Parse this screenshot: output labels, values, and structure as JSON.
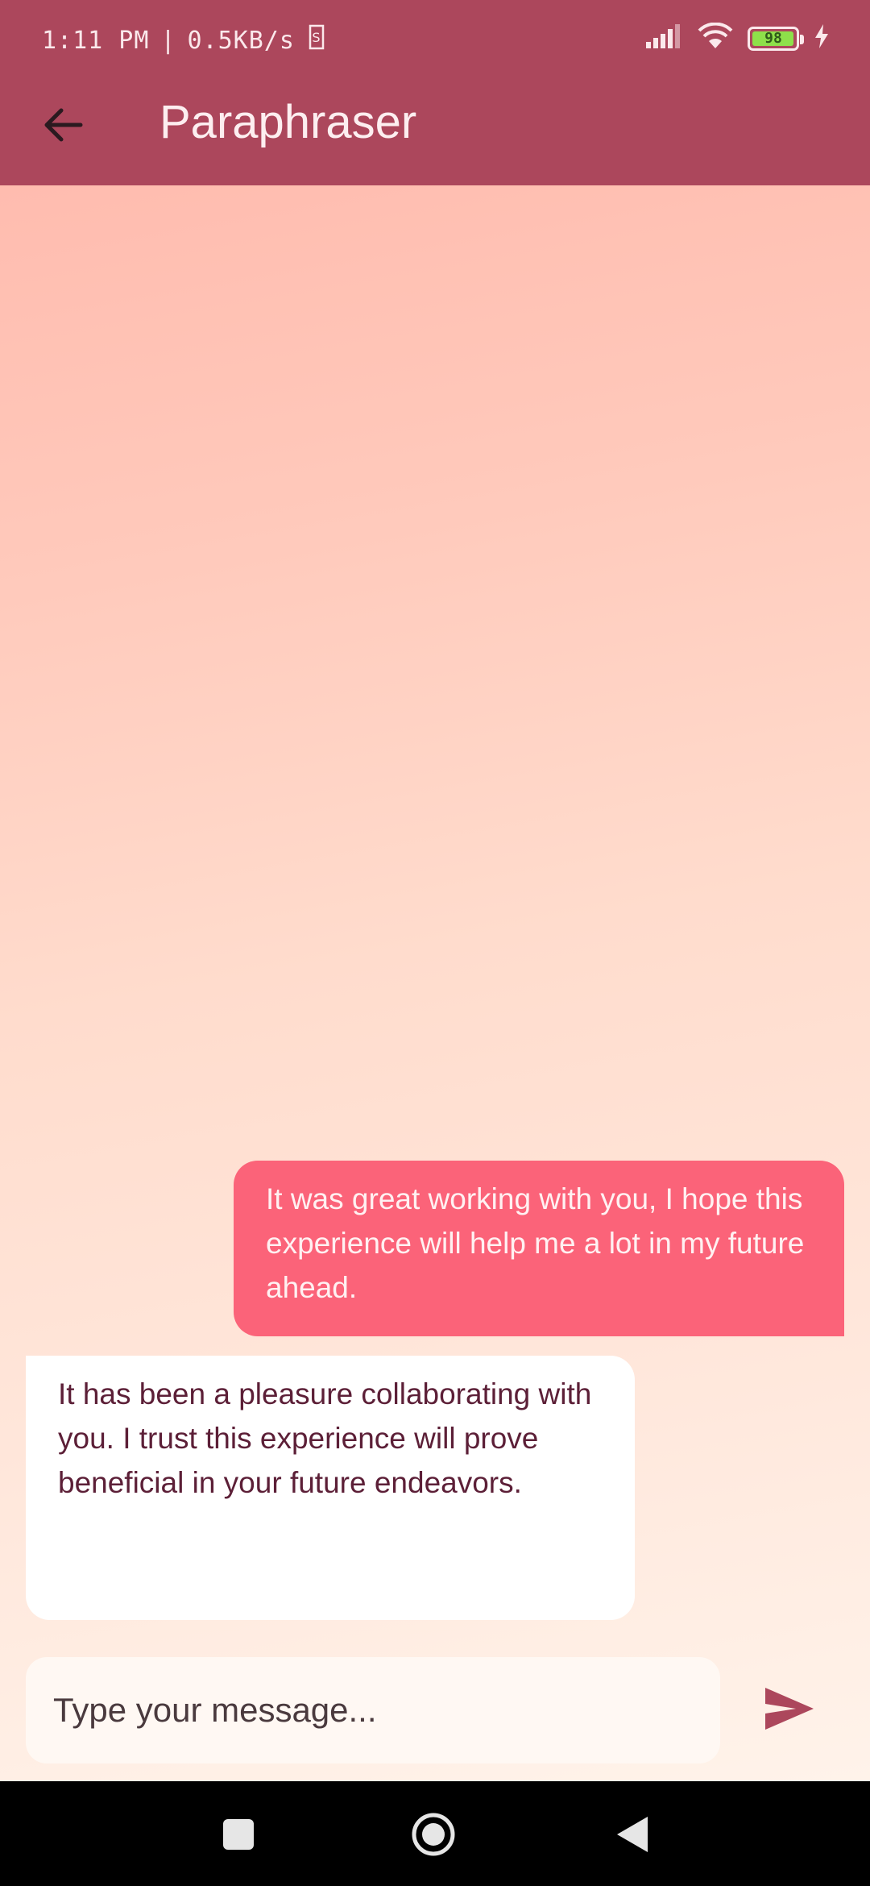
{
  "status_bar": {
    "time": "1:11 PM",
    "separator": "|",
    "network_speed": "0.5KB/s",
    "battery_level": "98",
    "battery_fraction": 0.98,
    "icons": [
      "sim-icon",
      "signal-icon",
      "wifi-icon",
      "battery-icon",
      "charging-icon"
    ]
  },
  "app_bar": {
    "title": "Paraphraser",
    "back_icon": "arrow-left-icon"
  },
  "messages": [
    {
      "role": "user",
      "text": "It was great working with you, I hope this experience will help me a lot in my future ahead."
    },
    {
      "role": "bot",
      "text": "It has been a pleasure collaborating with you. I trust this experience will prove beneficial in your future endeavors."
    }
  ],
  "composer": {
    "placeholder": "Type your message...",
    "value": "",
    "send_icon": "send-icon"
  },
  "nav_bar": {
    "icons": [
      "recents-icon",
      "home-icon",
      "back-triangle-icon"
    ]
  },
  "colors": {
    "header": "#ac475c",
    "user_bubble": "#fb6379",
    "bot_bubble": "#ffffff",
    "accent": "#ac475c"
  }
}
